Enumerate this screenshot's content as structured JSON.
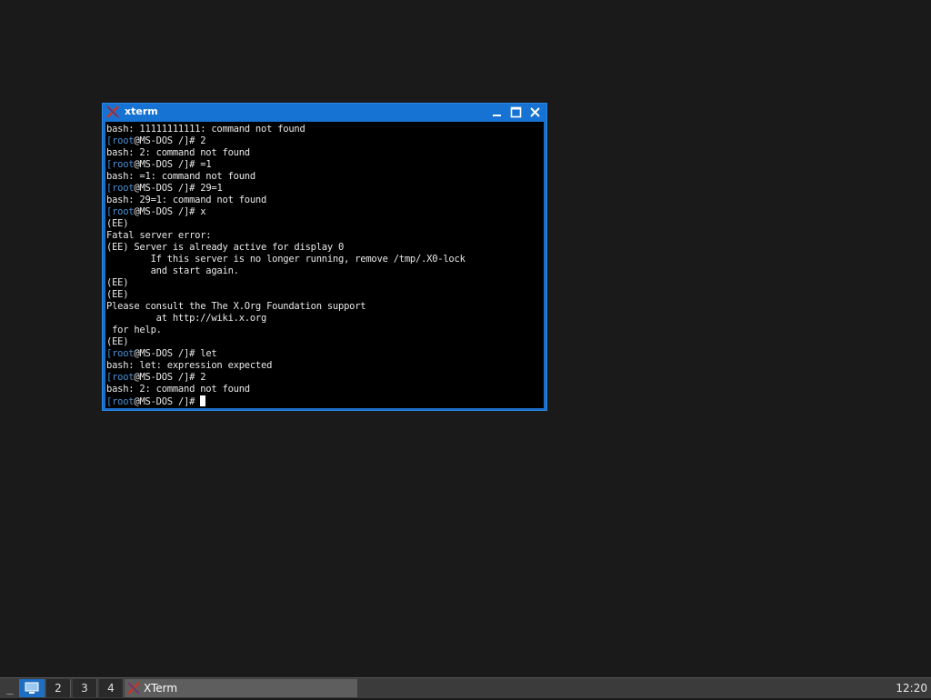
{
  "window": {
    "title": "xterm",
    "icon": "x-logo-icon",
    "buttons": [
      "minimize-icon",
      "maximize-icon",
      "close-icon"
    ]
  },
  "terminal": {
    "prompt": {
      "open_bracket": "[",
      "user": "root",
      "host": "@MS-DOS /]",
      "symbol": "# "
    },
    "lines": [
      {
        "type": "out",
        "text": "bash: 11111111111: command not found"
      },
      {
        "type": "prompt",
        "cmd": "2"
      },
      {
        "type": "out",
        "text": "bash: 2: command not found"
      },
      {
        "type": "prompt",
        "cmd": "=1"
      },
      {
        "type": "out",
        "text": "bash: =1: command not found"
      },
      {
        "type": "prompt",
        "cmd": "29=1"
      },
      {
        "type": "out",
        "text": "bash: 29=1: command not found"
      },
      {
        "type": "prompt",
        "cmd": "x"
      },
      {
        "type": "out",
        "text": "(EE)"
      },
      {
        "type": "out",
        "text": "Fatal server error:"
      },
      {
        "type": "out",
        "text": "(EE) Server is already active for display 0"
      },
      {
        "type": "out",
        "text": "        If this server is no longer running, remove /tmp/.X0-lock"
      },
      {
        "type": "out",
        "text": "        and start again."
      },
      {
        "type": "out",
        "text": "(EE)"
      },
      {
        "type": "out",
        "text": "(EE)"
      },
      {
        "type": "out",
        "text": "Please consult the The X.Org Foundation support"
      },
      {
        "type": "out",
        "text": "         at http://wiki.x.org"
      },
      {
        "type": "out",
        "text": " for help."
      },
      {
        "type": "out",
        "text": "(EE)"
      },
      {
        "type": "prompt",
        "cmd": "let"
      },
      {
        "type": "out",
        "text": "bash: let: expression expected"
      },
      {
        "type": "prompt",
        "cmd": "2"
      },
      {
        "type": "out",
        "text": "bash: 2: command not found"
      },
      {
        "type": "prompt",
        "cmd": "",
        "cursor": true
      }
    ]
  },
  "taskbar": {
    "menu_label": "_",
    "workspaces": [
      {
        "label": "",
        "icon": "desktop-icon",
        "active": true
      },
      {
        "label": "2",
        "active": false
      },
      {
        "label": "3",
        "active": false
      },
      {
        "label": "4",
        "active": false
      }
    ],
    "tasks": [
      {
        "label": "XTerm",
        "icon": "x-logo-icon",
        "active": true
      }
    ],
    "clock": "12:20"
  },
  "colors": {
    "desktop": "#1a1a1a",
    "titlebar": "#1773d3",
    "terminal_bg": "#000000",
    "terminal_fg": "#e8e8e8",
    "prompt_accent": "#4a8fd6",
    "taskbar": "#3b3b3b",
    "workspace_active": "#1e6fc3"
  }
}
